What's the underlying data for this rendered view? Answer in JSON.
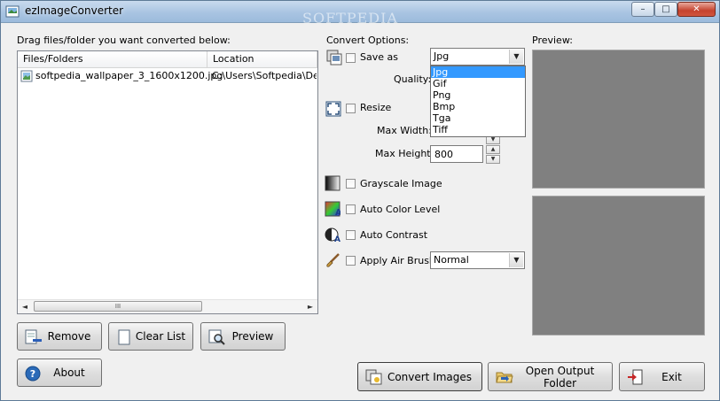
{
  "window": {
    "title": "ezImageConverter",
    "watermark": "SOFTPEDIA"
  },
  "titlebar_buttons": {
    "minimize": "–",
    "maximize": "□",
    "close": "✕"
  },
  "files": {
    "instruction": "Drag files/folder you want converted below:",
    "columns": [
      "Files/Folders",
      "Location"
    ],
    "rows": [
      {
        "name": "softpedia_wallpaper_3_1600x1200.jpg",
        "location": "C:\\Users\\Softpedia\\Deskt"
      }
    ],
    "scroll_thumb_grip": "III",
    "scroll_left": "◄",
    "scroll_right": "►"
  },
  "actions": {
    "remove": "Remove",
    "clear_list": "Clear List",
    "preview": "Preview",
    "about": "About",
    "convert": "Convert Images",
    "open_output": "Open Output Folder",
    "exit": "Exit"
  },
  "convert_options": {
    "header": "Convert Options:",
    "save_as": {
      "label": "Save as",
      "value": "Jpg",
      "options": [
        "Jpg",
        "Gif",
        "Png",
        "Bmp",
        "Tga",
        "Tiff"
      ]
    },
    "quality": {
      "label": "Quality:"
    },
    "resize": {
      "label": "Resize"
    },
    "max_width": {
      "label": "Max Width:"
    },
    "max_height": {
      "label": "Max Height:",
      "value": "800"
    },
    "grayscale": {
      "label": "Grayscale Image"
    },
    "auto_color": {
      "label": "Auto Color Level"
    },
    "auto_contrast": {
      "label": "Auto Contrast"
    },
    "air_brush": {
      "label": "Apply Air Brush",
      "value": "Normal"
    }
  },
  "preview": {
    "header": "Preview:"
  },
  "icons": {
    "save_as": "image-convert-icon",
    "resize": "resize-icon",
    "grayscale": "grayscale-icon",
    "auto_color": "color-level-icon",
    "auto_contrast": "contrast-icon",
    "air_brush": "brush-icon"
  },
  "colors": {
    "preview_bg": "#808080",
    "selection": "#3399ff",
    "titlebar": "#a9c4e2"
  }
}
